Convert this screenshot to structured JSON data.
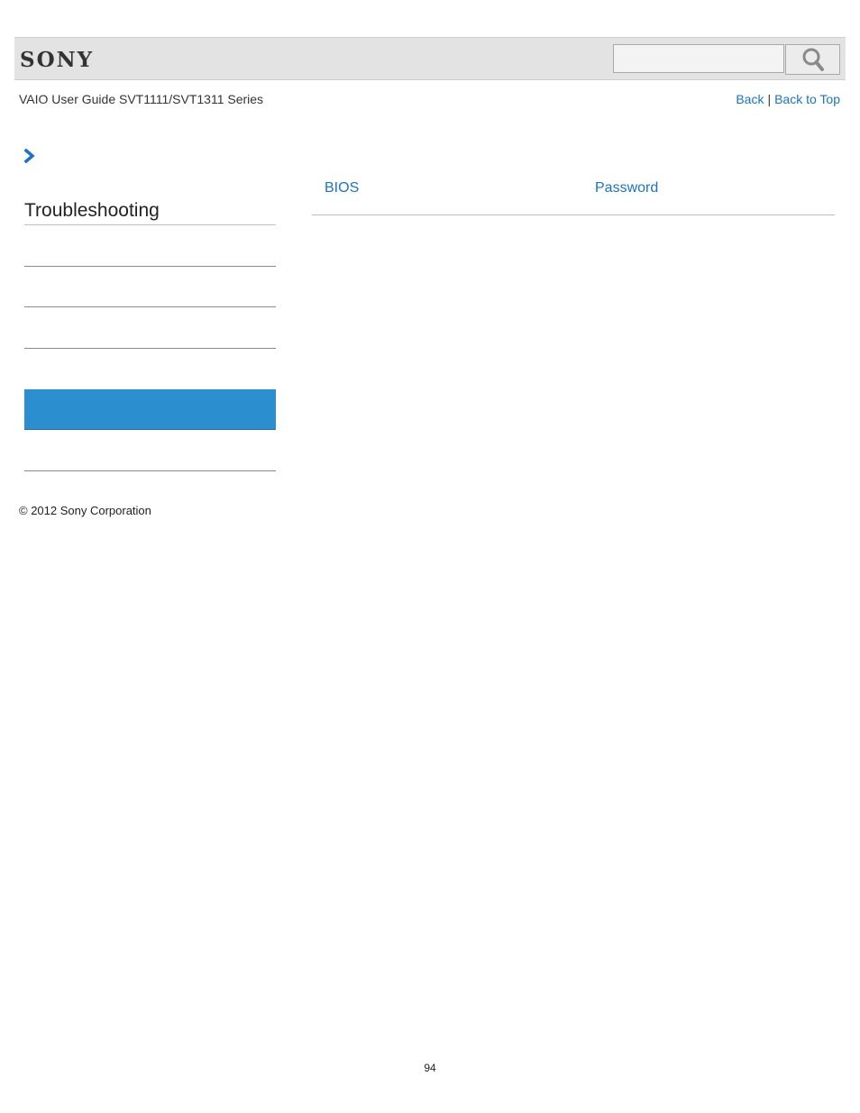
{
  "header": {
    "brand": "SONY",
    "search": {
      "value": "",
      "placeholder": ""
    },
    "search_icon": "magnifier-icon"
  },
  "subheader": {
    "guide_title": "VAIO User Guide SVT1111/SVT1311 Series",
    "back_label": "Back",
    "separator": "|",
    "back_to_top_label": "Back to Top"
  },
  "breadcrumb": {
    "icon": "chevron-right-icon"
  },
  "sidebar": {
    "title": "Troubleshooting",
    "items": [
      {
        "label": "",
        "active": false
      },
      {
        "label": "",
        "active": false
      },
      {
        "label": "",
        "active": false
      },
      {
        "label": "",
        "active": true
      },
      {
        "label": "",
        "active": false
      }
    ]
  },
  "content": {
    "links": [
      "BIOS",
      "Password"
    ]
  },
  "footer": {
    "copyright": "© 2012 Sony Corporation",
    "page_number": "94"
  },
  "colors": {
    "link": "#1a73c9",
    "active_item": "#2b8fcf",
    "header_bg": "#e3e3e3"
  }
}
